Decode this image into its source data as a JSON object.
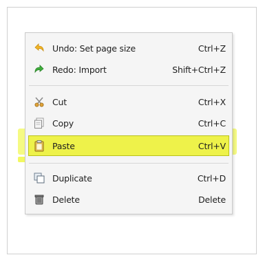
{
  "menu": {
    "items": [
      {
        "key": "undo",
        "label": "Undo: Set page size",
        "shortcut": "Ctrl+Z",
        "icon": "undo-arrow-icon"
      },
      {
        "key": "redo",
        "label": "Redo: Import",
        "shortcut": "Shift+Ctrl+Z",
        "icon": "redo-arrow-icon"
      },
      {
        "key": "cut",
        "label": "Cut",
        "shortcut": "Ctrl+X",
        "icon": "scissors-icon"
      },
      {
        "key": "copy",
        "label": "Copy",
        "shortcut": "Ctrl+C",
        "icon": "copy-icon"
      },
      {
        "key": "paste",
        "label": "Paste",
        "shortcut": "Ctrl+V",
        "icon": "clipboard-icon"
      },
      {
        "key": "duplicate",
        "label": "Duplicate",
        "shortcut": "Ctrl+D",
        "icon": "duplicate-icon"
      },
      {
        "key": "delete",
        "label": "Delete",
        "shortcut": "Delete",
        "icon": "trash-icon"
      }
    ],
    "highlighted_item": "paste"
  },
  "colors": {
    "highlight": "#eef24a",
    "menu_background": "#f5f5f5",
    "undo_icon": "#f0b428",
    "redo_icon": "#3fae3c"
  }
}
